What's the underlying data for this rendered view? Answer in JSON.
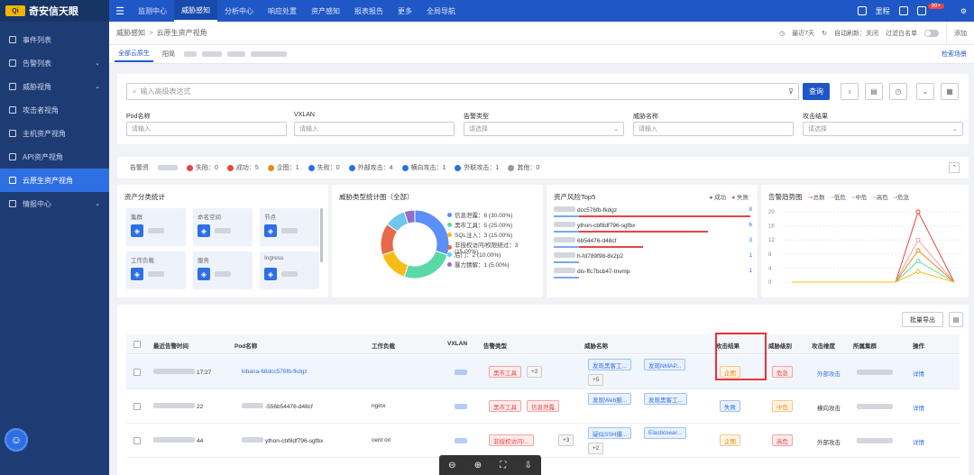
{
  "app": {
    "brand_badge": "Qi",
    "brand_name": "奇安信天眼"
  },
  "sidebar": {
    "items": [
      {
        "label": "事件列表",
        "icon": "list-icon",
        "has_children": false
      },
      {
        "label": "告警列表",
        "icon": "alert-icon",
        "has_children": true
      },
      {
        "label": "威胁视角",
        "icon": "threat-icon",
        "has_children": true
      },
      {
        "label": "攻击者视角",
        "icon": "attacker-icon",
        "has_children": false
      },
      {
        "label": "主机资产视角",
        "icon": "host-icon",
        "has_children": false
      },
      {
        "label": "API资产视角",
        "icon": "api-icon",
        "has_children": false
      },
      {
        "label": "云原生资产视角",
        "icon": "cloud-icon",
        "has_children": false,
        "active": true
      },
      {
        "label": "情报中心",
        "icon": "intel-icon",
        "has_children": true
      }
    ]
  },
  "topnav": {
    "items": [
      "监测中心",
      "威胁感知",
      "分析中心",
      "响应处置",
      "资产感知",
      "报表报告",
      "更多",
      "全局导航"
    ],
    "active_index": 1,
    "user": "里程",
    "notif_count": "99+"
  },
  "breadcrumb": {
    "items": [
      "威胁感知",
      "云原生资产视角"
    ],
    "time_range": "最近7天",
    "auto_refresh": "自动刷新：关闭",
    "whitelist_filter": "过滤白名单",
    "add_label": "添加"
  },
  "tabs": {
    "items": [
      "全部云原生",
      "阳简"
    ],
    "right_link": "检索场景"
  },
  "filters": {
    "search_placeholder": "输入高级表达式",
    "query_button": "查询",
    "fields": [
      {
        "label": "Pod名称",
        "placeholder": "请输入"
      },
      {
        "label": "VXLAN",
        "placeholder": "请输入"
      },
      {
        "label": "告警类型",
        "placeholder": "请选择"
      },
      {
        "label": "威胁名称",
        "placeholder": "请输入"
      },
      {
        "label": "攻击结果",
        "placeholder": "请选择"
      }
    ]
  },
  "alert_summary": {
    "label": "告警资",
    "items": [
      {
        "text": "失陷：0",
        "color": "#e84545"
      },
      {
        "text": "成功：5",
        "color": "#e84545"
      },
      {
        "text": "企图：1",
        "color": "#e88d16"
      },
      {
        "text": "失败：0",
        "color": "#2f6fe4"
      },
      {
        "text": "外部攻击：4",
        "color": "#2f6fe4"
      },
      {
        "text": "横向攻击：1",
        "color": "#2f6fe4"
      },
      {
        "text": "外联攻击：1",
        "color": "#2f6fe4"
      },
      {
        "text": "其他：0",
        "color": "#999999"
      }
    ]
  },
  "asset_stats": {
    "title": "资产分类统计",
    "tiles": [
      {
        "label": "集群",
        "icon": "cluster-icon"
      },
      {
        "label": "命名空间",
        "icon": "namespace-icon"
      },
      {
        "label": "节点",
        "icon": "node-icon"
      },
      {
        "label": "工作负载",
        "icon": "workload-icon"
      },
      {
        "label": "服务",
        "icon": "service-icon"
      },
      {
        "label": "Ingress",
        "icon": "ingress-icon"
      }
    ]
  },
  "chart_data": [
    {
      "type": "pie",
      "title": "威胁类型统计图（全部）",
      "categories": [
        "信息泄露",
        "黑市工具",
        "SQL注入",
        "非授权访问/权限绕过",
        "后门",
        "暴力猜解"
      ],
      "values": [
        6,
        5,
        3,
        3,
        2,
        1
      ],
      "labels": [
        "信息泄露：6 (30.00%)",
        "黑市工具：5 (25.00%)",
        "SQL注入：3 (15.00%)",
        "非授权访问/权限绕过：3 (15.00%)",
        "后门：2 (10.00%)",
        "暴力猜解：1 (5.00%)"
      ],
      "colors": [
        "#5b8ff9",
        "#5ad8a6",
        "#f6bd16",
        "#e8684a",
        "#6dc8ec",
        "#9270ca"
      ]
    },
    {
      "type": "bar",
      "title": "资产风险Top5",
      "legend": [
        "成功",
        "失败"
      ],
      "categories": [
        "dcc576fb-fkdgz",
        "ython-cbf8df796-sgfbx",
        "6b54476-d48cf",
        "h-fd789f98-8x2p2",
        "dis-ffc7bcb47-tnvmp"
      ],
      "values": [
        8,
        6,
        3,
        1,
        1
      ]
    },
    {
      "type": "line",
      "title": "告警趋势图",
      "legend": [
        "总数",
        "低危",
        "中危",
        "高危",
        "危急"
      ],
      "series": [
        {
          "name": "总数",
          "values": [
            0,
            0,
            0,
            0,
            0,
            0,
            20
          ]
        },
        {
          "name": "高危",
          "values": [
            0,
            0,
            0,
            0,
            0,
            0,
            12
          ]
        },
        {
          "name": "危急",
          "values": [
            0,
            0,
            0,
            0,
            0,
            0,
            9
          ]
        },
        {
          "name": "中危",
          "values": [
            0,
            0,
            0,
            0,
            0,
            0,
            6
          ]
        },
        {
          "name": "低危",
          "values": [
            0,
            0,
            0,
            0,
            0,
            0,
            3
          ]
        }
      ],
      "colors": [
        "#e84545",
        "#f6bd16",
        "#5ad8a6",
        "#ff9d9d",
        "#e88d16"
      ],
      "y_ticks": [
        "20",
        "16",
        "12",
        "8",
        "4",
        "0"
      ]
    }
  ],
  "table": {
    "export_label": "批量导出",
    "columns": [
      "最近告警时间",
      "Pod名称",
      "工作负载",
      "VXLAN",
      "告警类型",
      "威胁名称",
      "攻击结果",
      "威胁级别",
      "攻击维度",
      "所属集群",
      "操作"
    ],
    "rows": [
      {
        "time": "17:27",
        "pod": "kibana-68dcc576fb-fkdgz",
        "types": [
          "黑市工具"
        ],
        "type_more": "+2",
        "threats": [
          "发现黑客工...",
          "发现NMAP..."
        ],
        "threat_more": "+5",
        "result": "企图",
        "level": "危急",
        "dimension": "外部攻击",
        "action": "详情"
      },
      {
        "time": "22",
        "pod": "-556b54476-d48cf",
        "workload": "nginx",
        "types": [
          "黑市工具",
          "信息泄露"
        ],
        "threats": [
          "发现Web服...",
          "发现黑客工..."
        ],
        "result": "失败",
        "level": "中危",
        "dimension": "横向攻击",
        "action": "详情"
      },
      {
        "time": "44",
        "pod": "ython-cbf8df796-sgfbx",
        "workload": "cent   on",
        "types": [
          "非授权访问/..."
        ],
        "type_more": "+3",
        "threats": [
          "疑似SSH爆...",
          "Elasticsear..."
        ],
        "threat_more": "+2",
        "result": "企图",
        "level": "高危",
        "dimension": "外部攻击",
        "action": "详情"
      }
    ]
  }
}
